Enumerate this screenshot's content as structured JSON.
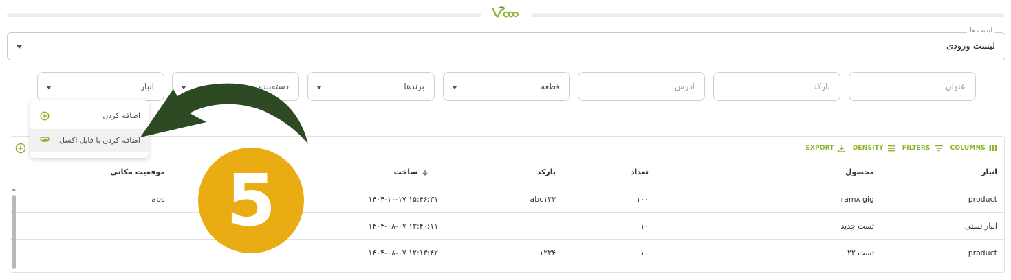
{
  "colors": {
    "accent": "#8cb32b",
    "badge": "#e9ac12",
    "arrow": "#2e4a22"
  },
  "list_select": {
    "legend": "لیست ها",
    "value": "لیست ورودی"
  },
  "filters": [
    {
      "key": "title",
      "text": "عنوان",
      "kind": "placeholder"
    },
    {
      "key": "barcode",
      "text": "بارکد",
      "kind": "placeholder"
    },
    {
      "key": "address",
      "text": "آدرس",
      "kind": "placeholder"
    },
    {
      "key": "part",
      "text": "قطعه",
      "kind": "select"
    },
    {
      "key": "brands",
      "text": "برندها",
      "kind": "select"
    },
    {
      "key": "category",
      "text": "دسته‌بندی",
      "kind": "select"
    },
    {
      "key": "warehouse",
      "text": "انبار",
      "kind": "select"
    }
  ],
  "menu": {
    "add": {
      "label": "اضافه کردن",
      "icon": "plus-circle-icon"
    },
    "add_excel": {
      "label": "اضافه کردن با فایل اکسل",
      "icon": "attachment-icon"
    }
  },
  "toolbar": {
    "columns": "COLUMNS",
    "filters": "FILTERS",
    "density": "DENSITY",
    "export": "EXPORT"
  },
  "table": {
    "headers": {
      "warehouse": "انبار",
      "product": "محصول",
      "quantity": "تعداد",
      "barcode": "بارکد",
      "created": "ساخت",
      "location": "موقعیت مکانی"
    },
    "rows": [
      {
        "warehouse": "product",
        "product": "ram۸ gig",
        "quantity": "۱۰۰",
        "barcode": "abc۱۲۳",
        "created": "۱۴۰۴-۱۰-۱۷ ۱۵:۴۶:۳۱",
        "location": "abc"
      },
      {
        "warehouse": "انبار تستی",
        "product": "تست جدید",
        "quantity": "۱۰",
        "barcode": "",
        "created": "۱۴۰۴-۰۸-۰۷ ۱۳:۴۰:۱۱",
        "location": ""
      },
      {
        "warehouse": "product",
        "product": "تست ۲۲",
        "quantity": "۱۰",
        "barcode": "۱۲۳۴",
        "created": "۱۴۰۴-۰۸-۰۷ ۱۲:۱۳:۴۲",
        "location": ""
      }
    ]
  },
  "badge": {
    "number": "5"
  }
}
